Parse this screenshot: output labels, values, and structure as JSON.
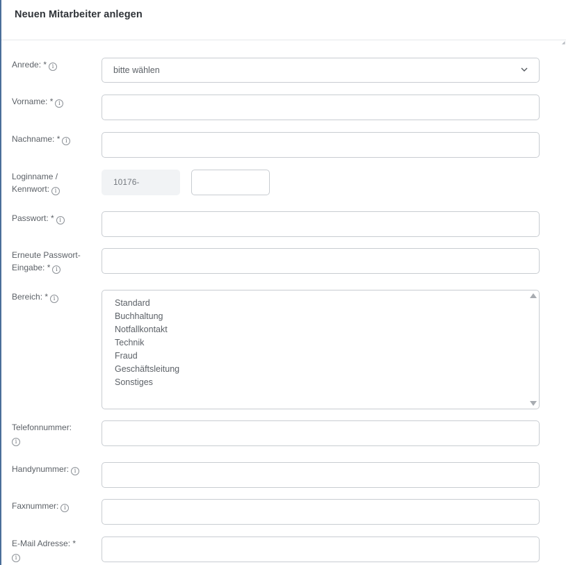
{
  "dialog": {
    "title": "Neuen Mitarbeiter anlegen"
  },
  "fields": {
    "anrede": {
      "label": "Anrede: *",
      "value": "bitte wählen"
    },
    "vorname": {
      "label": "Vorname: *",
      "value": ""
    },
    "nachname": {
      "label": "Nachname: *",
      "value": ""
    },
    "loginname": {
      "label_line1": "Loginname /",
      "label_line2": "Kennwort:",
      "prefix": "10176-",
      "value": ""
    },
    "passwort": {
      "label": "Passwort: *",
      "value": ""
    },
    "passwort_repeat": {
      "label_line1": "Erneute Passwort-",
      "label_line2": "Eingabe: *",
      "value": ""
    },
    "bereich": {
      "label": "Bereich: *",
      "options": [
        "Standard",
        "Buchhaltung",
        "Notfallkontakt",
        "Technik",
        "Fraud",
        "Geschäftsleitung",
        "Sonstiges"
      ]
    },
    "telefon": {
      "label": "Telefonnummer:",
      "value": ""
    },
    "handy": {
      "label": "Handynummer:",
      "value": ""
    },
    "fax": {
      "label": "Faxnummer:",
      "value": ""
    },
    "email": {
      "label": "E-Mail Adresse: *",
      "value": ""
    }
  },
  "icons": {
    "info": "i",
    "chevron": "chevron-down-icon"
  }
}
